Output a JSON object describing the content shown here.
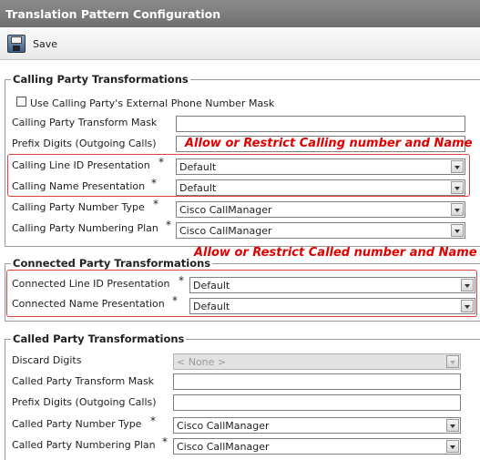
{
  "window": {
    "title": "Translation Pattern Configuration"
  },
  "toolbar": {
    "save_label": "Save"
  },
  "calling": {
    "legend": "Calling Party Transformations",
    "use_mask_label": "Use Calling Party's External Phone Number Mask",
    "transform_mask_label": "Calling Party Transform Mask",
    "transform_mask_value": "",
    "prefix_label": "Prefix Digits (Outgoing Calls)",
    "prefix_value": "",
    "line_id_label": "Calling Line ID Presentation",
    "line_id_value": "Default",
    "name_label": "Calling Name Presentation",
    "name_value": "Default",
    "number_type_label": "Calling Party Number Type",
    "number_type_value": "Cisco CallManager",
    "numbering_plan_label": "Calling Party Numbering Plan",
    "numbering_plan_value": "Cisco CallManager",
    "required_mark": "*"
  },
  "connected": {
    "legend": "Connected Party Transformations",
    "line_id_label": "Connected Line ID Presentation",
    "line_id_value": "Default",
    "name_label": "Connected Name Presentation",
    "name_value": "Default",
    "required_mark": "*"
  },
  "called": {
    "legend": "Called Party Transformations",
    "discard_label": "Discard Digits",
    "discard_value": "< None >",
    "transform_mask_label": "Called Party Transform Mask",
    "transform_mask_value": "",
    "prefix_label": "Prefix Digits (Outgoing Calls)",
    "prefix_value": "",
    "number_type_label": "Called Party Number Type",
    "number_type_value": "Cisco CallManager",
    "numbering_plan_label": "Called Party Numbering Plan",
    "numbering_plan_value": "Cisco CallManager",
    "required_mark": "*"
  },
  "annotations": {
    "calling_note": "Allow or Restrict Calling number and Name",
    "called_note": "Allow or Restrict Called number and Name",
    "color": "#e00000"
  }
}
